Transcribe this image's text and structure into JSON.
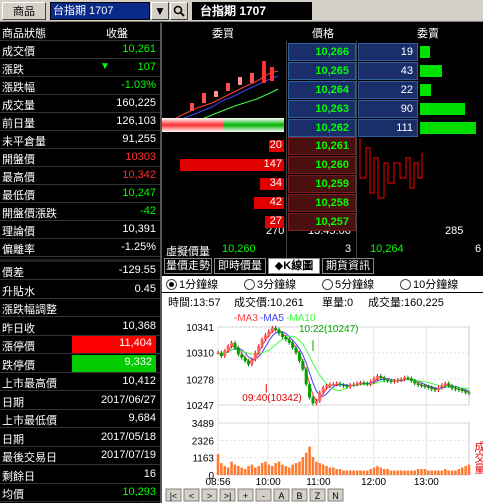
{
  "toolbar": {
    "product_btn": "商品",
    "symbol": "台指期 1707",
    "dropdown_glyph": "▼",
    "title": "台指期  1707"
  },
  "left_table": {
    "header_label": "商品狀態",
    "header_value": "收盤",
    "rows": [
      {
        "label": "成交價",
        "value": "10,261",
        "color": "#00ff00"
      },
      {
        "label": "漲跌",
        "value": "107",
        "arrow": "▼",
        "color": "#00ff00"
      },
      {
        "label": "漲跌幅",
        "value": "-1.03%",
        "color": "#00ff00"
      },
      {
        "label": "成交量",
        "value": "160,225",
        "color": "#ffffff"
      },
      {
        "label": "前日量",
        "value": "126,103",
        "color": "#ffffff"
      },
      {
        "label": "未平倉量",
        "value": "91,255",
        "color": "#ffffff"
      },
      {
        "label": "開盤價",
        "value": "10303",
        "color": "#ff3030"
      },
      {
        "label": "最高價",
        "value": "10,342",
        "color": "#ff3030"
      },
      {
        "label": "最低價",
        "value": "10,247",
        "color": "#00ff00"
      },
      {
        "label": "開盤價漲跌",
        "value": "-42",
        "color": "#00ff00"
      },
      {
        "label": "理論價",
        "value": "10,391",
        "color": "#ffffff"
      },
      {
        "label": "偏離率",
        "value": "-1.25%",
        "color": "#ffffff"
      }
    ],
    "rows2": [
      {
        "label": "價差",
        "value": "-129.55",
        "color": "#ffffff"
      },
      {
        "label": "升貼水",
        "value": "0.45",
        "color": "#ffffff"
      },
      {
        "label": "漲跌幅調整",
        "value": "",
        "color": "#ffffff"
      },
      {
        "label": "昨日收",
        "value": "10,368",
        "color": "#ffffff"
      },
      {
        "label": "漲停價",
        "value": "11,404",
        "color": "#ffffff",
        "bg": "#ff0000"
      },
      {
        "label": "跌停價",
        "value": "9,332",
        "color": "#ffffff",
        "bg": "#00cc00"
      },
      {
        "label": "上市最高價",
        "value": "10,412",
        "color": "#ffffff"
      },
      {
        "label": "日期",
        "value": "2017/06/27",
        "color": "#ffffff"
      },
      {
        "label": "上市最低價",
        "value": "9,684",
        "color": "#ffffff"
      },
      {
        "label": "日期",
        "value": "2017/05/18",
        "color": "#ffffff"
      },
      {
        "label": "最後交易日",
        "value": "2017/07/19",
        "color": "#ffffff"
      },
      {
        "label": "剩餘日",
        "value": "16",
        "color": "#ffffff"
      },
      {
        "label": "均價",
        "value": "10,293",
        "color": "#00ff00"
      }
    ]
  },
  "orderbook": {
    "headers": {
      "bid": "委買",
      "price": "價格",
      "ask": "委賣"
    },
    "asks": [
      {
        "price": "10,266",
        "qty": "19",
        "bar": 0.18
      },
      {
        "price": "10,265",
        "qty": "43",
        "bar": 0.39
      },
      {
        "price": "10,264",
        "qty": "22",
        "bar": 0.2
      },
      {
        "price": "10,263",
        "qty": "90",
        "bar": 0.81
      },
      {
        "price": "10,262",
        "qty": "111",
        "bar": 1.0
      }
    ],
    "bids": [
      {
        "price": "10,261",
        "qty": "20",
        "bar": 0.14
      },
      {
        "price": "10,260",
        "qty": "147",
        "bar": 1.0
      },
      {
        "price": "10,259",
        "qty": "34",
        "bar": 0.23
      },
      {
        "price": "10,258",
        "qty": "42",
        "bar": 0.29
      },
      {
        "price": "10,257",
        "qty": "27",
        "bar": 0.18
      }
    ],
    "totals": {
      "bid_total": "270",
      "time": "13:45:00",
      "ask_total": "285"
    },
    "virtual": {
      "label": "虛擬價量",
      "bid_price": "10,260",
      "bid_qty": "3",
      "ask_price": "10,264",
      "ask_qty": "6"
    }
  },
  "tabs": [
    "量價走勢",
    "即時價量",
    "◆K線圖",
    "期貨資訊"
  ],
  "active_tab": 2,
  "intervals": [
    "1分鐘線",
    "3分鐘線",
    "5分鐘線",
    "10分鐘線"
  ],
  "chart_info": {
    "time_label": "時間:13:57",
    "close_label": "成交價:10,261",
    "unit_label": "單量:0",
    "vol_label": "成交量:160,225"
  },
  "legend": [
    "-MA3",
    "-MA5",
    "-MA10"
  ],
  "annotations": {
    "high": "10:22(10247)",
    "low": "09:40(10342)"
  },
  "vol_side_label": "成交量",
  "nav_buttons": [
    "|<",
    "<",
    ">",
    ">|",
    "+",
    "-",
    "A",
    "B",
    "Z",
    "N"
  ],
  "chart_data": {
    "type": "line",
    "title": "",
    "xlabel": "",
    "ylabel": "",
    "price_ticks": [
      "10341",
      "10310",
      "10278",
      "10247"
    ],
    "volume_ticks": [
      "3489",
      "2326",
      "1163",
      "0"
    ],
    "time_ticks": [
      "08:56",
      "10:00",
      "11:00",
      "12:00",
      "13:00"
    ],
    "ylim": [
      10247,
      10341
    ],
    "series": [
      {
        "name": "MA3",
        "color": "#ff4040"
      },
      {
        "name": "MA5",
        "color": "#4040ff"
      },
      {
        "name": "MA10",
        "color": "#40ff40"
      }
    ],
    "price": [
      10310,
      10306,
      10312,
      10318,
      10322,
      10316,
      10308,
      10304,
      10300,
      10296,
      10302,
      10310,
      10318,
      10326,
      10331,
      10336,
      10340,
      10338,
      10333,
      10329,
      10326,
      10322,
      10316,
      10310,
      10300,
      10290,
      10272,
      10256,
      10249,
      10252,
      10262,
      10268,
      10270,
      10272,
      10272,
      10273,
      10271,
      10270,
      10269,
      10271,
      10272,
      10273,
      10274,
      10273,
      10272,
      10275,
      10279,
      10282,
      10280,
      10277,
      10276,
      10275,
      10276,
      10277,
      10278,
      10280,
      10279,
      10276,
      10273,
      10271,
      10270,
      10269,
      10268,
      10266,
      10265,
      10268,
      10271,
      10273,
      10270,
      10267,
      10266,
      10265,
      10264,
      10262,
      10261
    ],
    "volume": [
      1400,
      800,
      600,
      500,
      900,
      700,
      600,
      500,
      400,
      600,
      700,
      500,
      600,
      800,
      900,
      700,
      600,
      800,
      900,
      700,
      600,
      500,
      700,
      800,
      900,
      1200,
      1500,
      1900,
      1200,
      900,
      800,
      700,
      600,
      500,
      500,
      400,
      400,
      300,
      300,
      300,
      300,
      300,
      300,
      300,
      300,
      400,
      500,
      600,
      500,
      400,
      400,
      300,
      300,
      300,
      300,
      300,
      300,
      300,
      300,
      400,
      400,
      400,
      300,
      300,
      300,
      300,
      300,
      400,
      300,
      300,
      300,
      400,
      500,
      600,
      700
    ]
  }
}
